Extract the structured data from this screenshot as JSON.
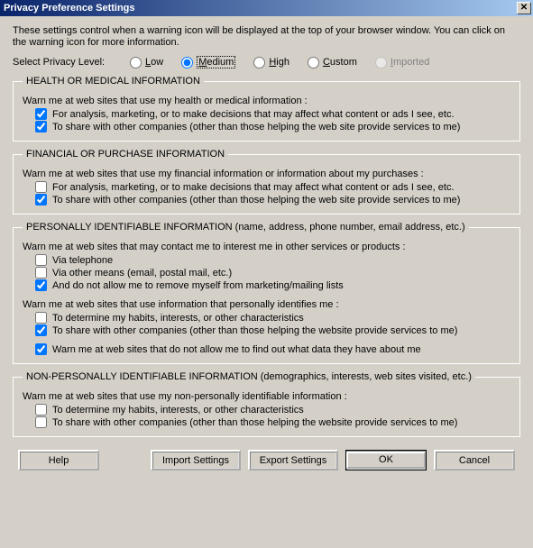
{
  "title": "Privacy Preference Settings",
  "intro": "These settings control when a warning icon will be displayed at the top of your browser window.  You can click on the warning icon for more information.",
  "level": {
    "label": "Select Privacy Level:",
    "options": {
      "low": "ow",
      "medium": "edium",
      "high": "igh",
      "custom": "ustom",
      "imported": "mported"
    },
    "prefix": {
      "low": "L",
      "medium": "M",
      "high": "H",
      "custom": "C",
      "imported": "I"
    },
    "selected": "medium",
    "imported_enabled": false
  },
  "groups": {
    "health": {
      "legend": "HEALTH OR MEDICAL INFORMATION",
      "subhead": "Warn me at web sites that use my health or medical information :",
      "items": [
        {
          "label": "For analysis, marketing, or to make decisions that may affect what content or ads I see, etc.",
          "checked": true
        },
        {
          "label": "To share with other companies (other than those helping the web site provide services to me)",
          "checked": true
        }
      ]
    },
    "financial": {
      "legend": "FINANCIAL OR PURCHASE INFORMATION",
      "subhead": "Warn me at web sites that use my financial information or information about my purchases :",
      "items": [
        {
          "label": "For analysis, marketing, or to make decisions that may affect what content or ads I see, etc.",
          "checked": false
        },
        {
          "label": "To share with other companies (other than those helping the web site provide services to me)",
          "checked": true
        }
      ]
    },
    "pii": {
      "legend": "PERSONALLY IDENTIFIABLE INFORMATION (name, address, phone number, email address, etc.)",
      "subhead1": "Warn me at web sites that may contact me to interest me in other services or products :",
      "items1": [
        {
          "label": "Via telephone",
          "checked": false
        },
        {
          "label": "Via other means (email, postal mail, etc.)",
          "checked": false
        },
        {
          "label": "And do not allow me to remove myself from marketing/mailing lists",
          "checked": true
        }
      ],
      "subhead2": "Warn me at web sites that use information that personally identifies me :",
      "items2": [
        {
          "label": "To determine my habits, interests, or other characteristics",
          "checked": false
        },
        {
          "label": "To share with other companies (other than those helping the website provide services to me)",
          "checked": true
        }
      ],
      "items3": [
        {
          "label": "Warn me at web sites that do not allow me to find out what data they have about me",
          "checked": true
        }
      ]
    },
    "nonpii": {
      "legend": "NON-PERSONALLY IDENTIFIABLE INFORMATION (demographics, interests, web sites visited, etc.)",
      "subhead": "Warn me at web sites that use my non-personally identifiable information :",
      "items": [
        {
          "label": "To determine my habits, interests, or other characteristics",
          "checked": false
        },
        {
          "label": "To share with other companies (other than those helping the website provide services to me)",
          "checked": false
        }
      ]
    }
  },
  "buttons": {
    "help": "Help",
    "import": "Import Settings",
    "export": "Export Settings",
    "ok": "OK",
    "cancel": "Cancel"
  }
}
